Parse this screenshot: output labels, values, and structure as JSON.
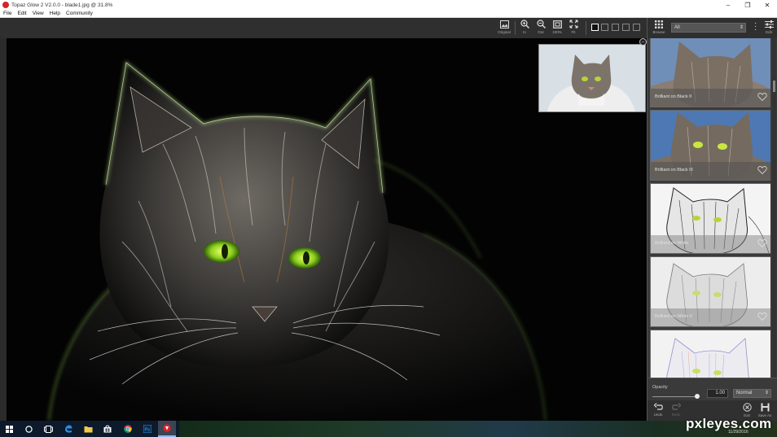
{
  "window": {
    "title": "Topaz Glow 2 V2.0.0 - blade1.jpg @ 31.8%",
    "controls": [
      "–",
      "❐",
      "✕"
    ]
  },
  "menu": [
    "File",
    "Edit",
    "View",
    "Help",
    "Community"
  ],
  "toolbar": {
    "original_label": "Original",
    "zoom_in_label": "In",
    "zoom_out_label": "Out",
    "zoom_100_label": "100%",
    "fit_label": "Fit"
  },
  "panel": {
    "browse_label": "Browse",
    "edit_label": "Edit",
    "filter_value": "All",
    "presets": [
      {
        "name": "Brilliant on Black II"
      },
      {
        "name": "Brilliant on Black III"
      },
      {
        "name": "Brilliant on White"
      },
      {
        "name": "Brilliant on White II"
      },
      {
        "name": ""
      }
    ],
    "opacity_label": "Opacity",
    "opacity_value": "1.00",
    "opacity_fraction": 1.0,
    "blend_mode": "Normal",
    "undo_label": "Undo",
    "redo_label": "Redo",
    "exit_label": "Exit",
    "save_as_label": "Save As"
  },
  "taskbar": {
    "clock": "11/29/2016"
  },
  "watermark": "pxleyes.com",
  "colors": {
    "app_accent": "#d6232a",
    "panel_bg": "#3a3a3a",
    "toolbar_bg": "#2f2f2f",
    "glow_green": "#9fe05a"
  }
}
